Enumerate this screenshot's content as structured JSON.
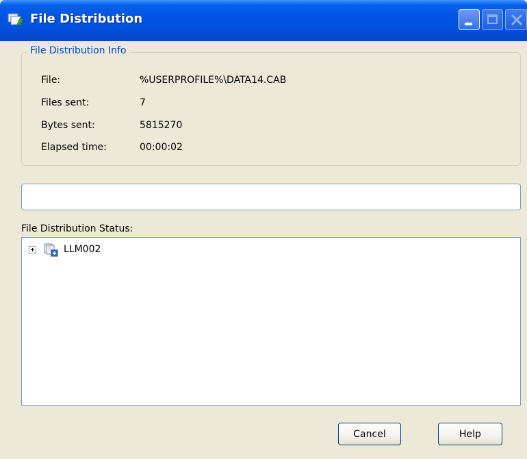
{
  "window": {
    "title": "File Distribution"
  },
  "info_group": {
    "legend": "File Distribution Info",
    "rows": [
      {
        "label": "File:",
        "value": "%USERPROFILE%\\DATA14.CAB"
      },
      {
        "label": "Files sent:",
        "value": "7"
      },
      {
        "label": "Bytes sent:",
        "value": "5815270"
      },
      {
        "label": "Elapsed time:",
        "value": "00:00:02"
      }
    ]
  },
  "progress": {
    "value_fraction": 0
  },
  "status": {
    "label": "File Distribution Status:",
    "tree": [
      {
        "label": "LLM002",
        "expanded": false,
        "icon": "computer-group-icon"
      }
    ]
  },
  "buttons": {
    "cancel": "Cancel",
    "help": "Help"
  },
  "icons": {
    "app": "file-distribution-icon",
    "minimize": "minimize-icon",
    "maximize": "maximize-icon",
    "close": "close-icon"
  },
  "colors": {
    "titlebar": "#0054e3",
    "window_bg": "#ece9d8",
    "group_legend": "#0046d5"
  }
}
